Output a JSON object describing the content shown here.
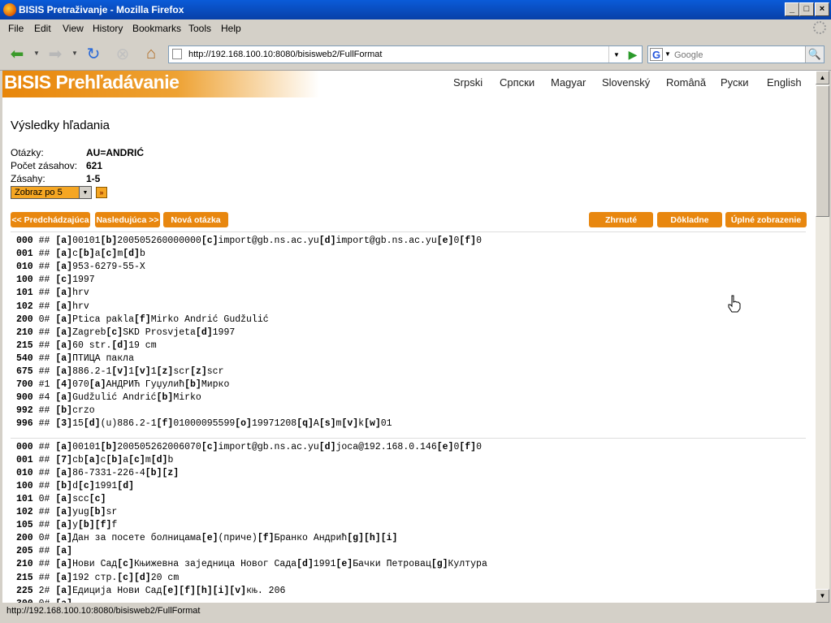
{
  "window": {
    "title": "BISIS Pretraživanje - Mozilla Firefox"
  },
  "menu": [
    "File",
    "Edit",
    "View",
    "History",
    "Bookmarks",
    "Tools",
    "Help"
  ],
  "url": "http://192.168.100.10:8080/bisisweb2/FullFormat",
  "search_placeholder": "Google",
  "status": "http://192.168.100.10:8080/bisisweb2/FullFormat",
  "banner": "BISIS Prehľadávanie",
  "languages": [
    "Srpski",
    "Српски",
    "Magyar",
    "Slovenský",
    "Română",
    "Руски",
    "English"
  ],
  "heading": "Výsledky hľadania",
  "info": [
    {
      "label": "Otázky:",
      "value": "AU=ANDRIĆ"
    },
    {
      "label": "Počet zásahov:",
      "value": "621"
    },
    {
      "label": "Zásahy:",
      "value": "1-5"
    }
  ],
  "page_size_select": "Zobraz po 5",
  "buttons_left": [
    "<< Predchádzajúca",
    "Nasledujúca >>",
    "Nová otázka"
  ],
  "buttons_right": [
    "Zhrnuté",
    "Dôkladne",
    "Úplné zobrazenie"
  ],
  "records": [
    [
      {
        "tag": "000",
        "ind": "##",
        "body": "[a]00101[b]200505260000000[c]import@gb.ns.ac.yu[d]import@gb.ns.ac.yu[e]0[f]0"
      },
      {
        "tag": "001",
        "ind": "##",
        "body": "[a]c[b]a[c]m[d]b"
      },
      {
        "tag": "010",
        "ind": "##",
        "body": "[a]953-6279-55-X"
      },
      {
        "tag": "100",
        "ind": "##",
        "body": "[c]1997"
      },
      {
        "tag": "101",
        "ind": "##",
        "body": "[a]hrv"
      },
      {
        "tag": "102",
        "ind": "##",
        "body": "[a]hrv"
      },
      {
        "tag": "200",
        "ind": "0#",
        "body": "[a]Ptica pakla[f]Mirko Andrić Gudžulić"
      },
      {
        "tag": "210",
        "ind": "##",
        "body": "[a]Zagreb[c]SKD Prosvjeta[d]1997"
      },
      {
        "tag": "215",
        "ind": "##",
        "body": "[a]60 str.[d]19 cm"
      },
      {
        "tag": "540",
        "ind": "##",
        "body": "[a]ПТИЦА пакла"
      },
      {
        "tag": "675",
        "ind": "##",
        "body": "[a]886.2-1[v]1[v]1[z]scr[z]scr"
      },
      {
        "tag": "700",
        "ind": "#1",
        "body": "[4]070[a]АНДРИЋ Гуџулић[b]Мирко"
      },
      {
        "tag": "900",
        "ind": "#4",
        "body": "[a]Gudžulić Andrić[b]Mirko"
      },
      {
        "tag": "992",
        "ind": "##",
        "body": "[b]crzo"
      },
      {
        "tag": "996",
        "ind": "##",
        "body": "[3]15[d](u)886.2-1[f]01000095599[o]19971208[q]A[s]m[v]k[w]01"
      }
    ],
    [
      {
        "tag": "000",
        "ind": "##",
        "body": "[a]00101[b]200505262006070[c]import@gb.ns.ac.yu[d]joca@192.168.0.146[e]0[f]0"
      },
      {
        "tag": "001",
        "ind": "##",
        "body": "[7]cb[a]c[b]a[c]m[d]b"
      },
      {
        "tag": "010",
        "ind": "##",
        "body": "[a]86-7331-226-4[b][z]"
      },
      {
        "tag": "100",
        "ind": "##",
        "body": "[b]d[c]1991[d]"
      },
      {
        "tag": "101",
        "ind": "0#",
        "body": "[a]scc[c]"
      },
      {
        "tag": "102",
        "ind": "##",
        "body": "[a]yug[b]sr"
      },
      {
        "tag": "105",
        "ind": "##",
        "body": "[a]y[b][f]f"
      },
      {
        "tag": "200",
        "ind": "0#",
        "body": "[a]Дан за посете болницама[e](приче)[f]Бранко Андрић[g][h][i]"
      },
      {
        "tag": "205",
        "ind": "##",
        "body": "[a]"
      },
      {
        "tag": "210",
        "ind": "##",
        "body": "[a]Нови Сад[c]Књижевна заједница Новог Сада[d]1991[e]Бачки Петровац[g]Култура"
      },
      {
        "tag": "215",
        "ind": "##",
        "body": "[a]192 стр.[c][d]20 cm"
      },
      {
        "tag": "225",
        "ind": "2#",
        "body": "[a]Едиција Нови Сад[e][f][h][i][v]књ. 206"
      },
      {
        "tag": "300",
        "ind": "0#",
        "body": "[a]"
      }
    ]
  ]
}
